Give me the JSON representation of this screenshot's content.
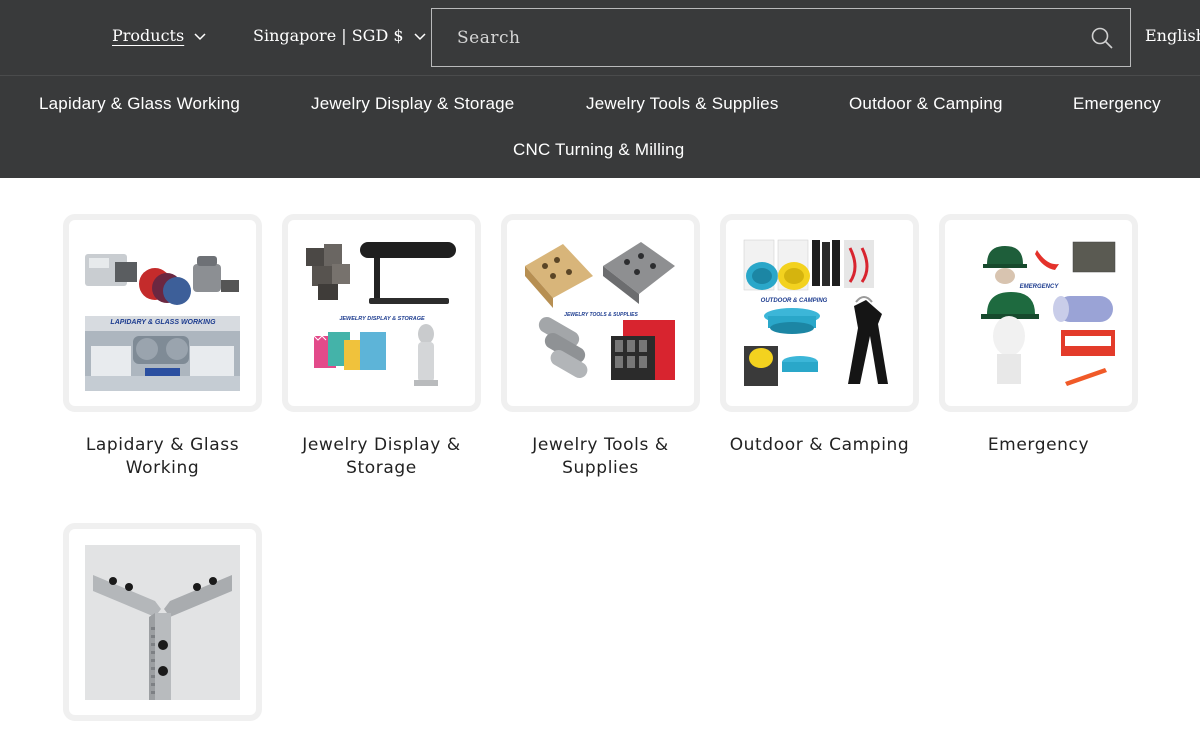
{
  "header": {
    "products_label": "Products",
    "region_label": "Singapore | SGD $",
    "search_placeholder": "Search",
    "language_label": "English"
  },
  "categories_nav": [
    {
      "label": "Lapidary & Glass Working"
    },
    {
      "label": "Jewelry Display & Storage"
    },
    {
      "label": "Jewelry Tools & Supplies"
    },
    {
      "label": "Outdoor & Camping"
    },
    {
      "label": "Emergency"
    },
    {
      "label": "CNC Turning & Milling"
    }
  ],
  "collections": [
    {
      "title": "Lapidary & Glass Working",
      "image_caption": "LAPIDARY & GLASS WORKING"
    },
    {
      "title": "Jewelry Display & Storage",
      "image_caption": "JEWELRY DISPLAY & STORAGE"
    },
    {
      "title": "Jewelry Tools & Supplies",
      "image_caption": "JEWELRY TOOLS & SUPPLIES"
    },
    {
      "title": "Outdoor & Camping",
      "image_caption": "OUTDOOR & CAMPING"
    },
    {
      "title": "Emergency",
      "image_caption": "EMERGENCY"
    },
    {
      "title": "",
      "image_caption": ""
    }
  ],
  "colors": {
    "header_bg": "#393a3b",
    "card_border": "#f0f0f0",
    "accent_blue": "#2aa7c9"
  }
}
